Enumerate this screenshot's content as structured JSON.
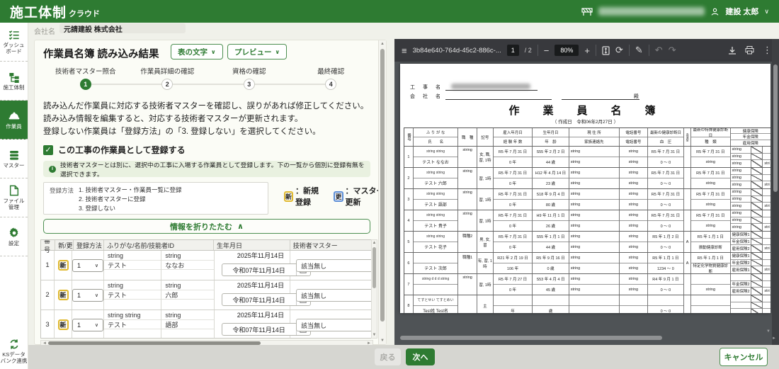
{
  "app": {
    "logo_main": "施工体制",
    "logo_sub": "クラウド",
    "user_name": "建設 太郎"
  },
  "sidebar": {
    "items": [
      {
        "id": "dashboard",
        "label": "ダッシュ\nボード",
        "icon": "checklist-icon",
        "active": false
      },
      {
        "id": "sekou-taisei",
        "label": "施工体制",
        "icon": "org-tree-icon",
        "active": false
      },
      {
        "id": "sagyouin",
        "label": "作業員",
        "icon": "helmet-icon",
        "active": true
      },
      {
        "id": "master",
        "label": "マスター",
        "icon": "database-icon",
        "active": false
      },
      {
        "id": "file-kanri",
        "label": "ファイル\n管理",
        "icon": "file-icon",
        "active": false
      },
      {
        "id": "settei",
        "label": "設定",
        "icon": "gear-icon",
        "active": false
      }
    ],
    "footer_item": {
      "id": "ks-databank",
      "label": "KSデータ\nバンク連携",
      "icon": "sync-icon"
    }
  },
  "company_bar": {
    "label": "会社名",
    "value": "元請建設 株式会社"
  },
  "panel": {
    "title": "作業員名簿 読み込み結果",
    "dropdown_table_text": "表の文字",
    "dropdown_preview": "プレビュー",
    "steps": [
      {
        "num": "1",
        "label": "技術者マスター照合",
        "active": true
      },
      {
        "num": "2",
        "label": "作業員詳細の確認",
        "active": false
      },
      {
        "num": "3",
        "label": "資格の確認",
        "active": false
      },
      {
        "num": "4",
        "label": "最終確認",
        "active": false
      }
    ],
    "description_lines": [
      "読み込んだ作業員に対応する技術者マスターを確認し、誤りがあれば修正してください。",
      "読み込み情報を編集すると、対応する技術者マスターが更新されます。",
      "登録しない作業員は「登録方法」の「3. 登録しない」を選択してください。"
    ],
    "register_checkbox_label": "この工事の作業員として登録する",
    "info_note": "技術者マスターとは別に、選択中の工事に入場する作業員として登録します。下の一覧から個別に登録有無を選択できます。",
    "legend": {
      "title": "登録方法",
      "options": [
        "1. 技術者マスター・作業員一覧に登録",
        "2. 技術者マスターに登録",
        "3. 登録しない"
      ],
      "badge_new": "新",
      "badge_new_label": "：新規登録",
      "badge_update": "更",
      "badge_update_label": "：マスター更新"
    },
    "collapse_button": "情報を折りたたむ",
    "collapse_chevron": "∧",
    "table": {
      "headers": [
        "番号",
        "新/更",
        "登録方法",
        "ふりがな/名前/技能者ID",
        "生年月日",
        "技術者マスター"
      ],
      "rows": [
        {
          "num": "1",
          "badge": "新",
          "method": "1",
          "kana_sei": "string",
          "kana_mei": "string",
          "sei": "テスト",
          "mei": "ななお",
          "birth_display": "2025年11月14日",
          "birth_input": "令和07年11月14日",
          "master": "該当無し",
          "partial": false
        },
        {
          "num": "2",
          "badge": "新",
          "method": "1",
          "kana_sei": "string",
          "kana_mei": "string",
          "sei": "テスト",
          "mei": "六郎",
          "birth_display": "2025年11月14日",
          "birth_input": "令和07年11月14日",
          "master": "該当無し",
          "partial": false
        },
        {
          "num": "3",
          "badge": "新",
          "method": "1",
          "kana_sei": "string string",
          "kana_mei": "string",
          "sei": "テスト",
          "mei": "語部",
          "birth_display": "2025年11月14日",
          "birth_input": "令和07年11月14日",
          "master": "該当無し",
          "partial": false
        },
        {
          "num": "",
          "badge": "",
          "method": "",
          "kana_sei": "string string",
          "kana_mei": "string",
          "sei": "",
          "mei": "",
          "birth_display": "H9 年 11 月 1 日",
          "birth_input": "",
          "master": "",
          "partial": true
        }
      ]
    }
  },
  "footer": {
    "back": "戻る",
    "next": "次へ",
    "cancel": "キャンセル"
  },
  "pdf": {
    "toolbar": {
      "filename": "3b84e640-764d-45c2-886c-...",
      "page": "1",
      "page_total": "/ 2",
      "zoom": "80%"
    },
    "doc": {
      "field_koji": "工　事　名",
      "field_kaisha": "会　社　名",
      "dono": "殿",
      "title": "作　業　員　名　簿",
      "date_line": "（ 作成日　令和06年2月27日 ）",
      "headers": {
        "num": "番号",
        "kana": "ふ り が な",
        "name": "氏　　名",
        "job": "職　種",
        "mark": "記号",
        "hire": "雇入年月日",
        "exp": "経 験 年 数",
        "birth": "生年月日",
        "age": "年　齢",
        "addr": "現 住 所",
        "family": "家族連絡先",
        "tel1": "電話番号",
        "tel2": "電話番号",
        "checkup": "最新の健康診断日",
        "bp": "血　圧",
        "blood": "血液型",
        "special": "最新の特殊健康診断日",
        "kind": "種　類",
        "ins1": "健康保険",
        "ins2": "年金保険",
        "ins3": "雇用保険"
      },
      "rows": [
        {
          "no": "1",
          "kana": "string string",
          "name": "テスト ななお",
          "job": "string",
          "mark": "女, 職, 習, 1特",
          "hire": "R5 年 7 月 31 日",
          "exp": "0 年",
          "birth": "S55 年 2 月 2 日",
          "age": "44 歳",
          "addr": "string",
          "family": "string",
          "tel1": "string",
          "tel2": "string",
          "checkup": "R5 年 7 月 31 日",
          "bp": "0 ～ 0",
          "blood": "",
          "special": "R5 年 7 月 31 日",
          "kind": "string",
          "ins": [
            "string",
            "string",
            "string"
          ],
          "cut": "stri"
        },
        {
          "no": "2",
          "kana": "string string",
          "name": "テスト 六郎",
          "job": "string",
          "mark": "習, 1時",
          "hire": "R5 年 7 月 31 日",
          "exp": "0 年",
          "birth": "H12 年 4 月 14 日",
          "age": "23 歳",
          "addr": "string",
          "family": "string",
          "tel1": "string",
          "tel2": "string",
          "checkup": "R5 年 7 月 31 日",
          "bp": "0 ～ 0",
          "blood": "",
          "special": "R5 年 7 月 31 日",
          "kind": "string",
          "ins": [
            "string",
            "string",
            "string"
          ],
          "cut": "stri"
        },
        {
          "no": "3",
          "kana": "string string",
          "name": "テスト 語部",
          "job": "string",
          "mark": "習, 1時",
          "hire": "R5 年 7 月 31 日",
          "exp": "0 年",
          "birth": "S18 年 9 月 4 日",
          "age": "80 歳",
          "addr": "string",
          "family": "string",
          "tel1": "string",
          "tel2": "string",
          "checkup": "R5 年 7 月 31 日",
          "bp": "0 ～ 0",
          "blood": "",
          "special": "R5 年 7 月 31 日",
          "kind": "string",
          "ins": [
            "string",
            "string",
            "string"
          ],
          "cut": "stri"
        },
        {
          "no": "4",
          "kana": "string string",
          "name": "テスト 貴子",
          "job": "string",
          "mark": "習, 1時",
          "hire": "R5 年 7 月 31 日",
          "exp": "0 年",
          "birth": "H9 年 11 月 1 日",
          "age": "26 歳",
          "addr": "string",
          "family": "string",
          "tel1": "string",
          "tel2": "string",
          "checkup": "R5 年 7 月 31 日",
          "bp": "0 ～ 0",
          "blood": "",
          "special": "R5 年 7 月 31 日",
          "kind": "string",
          "ins": [
            "string",
            "string",
            "string"
          ],
          "cut": "stri"
        },
        {
          "no": "5",
          "kana": "string string",
          "name": "テスト 花子",
          "job": "職種2",
          "mark": "男, 女, 習",
          "hire": "R5 年 7 月 31 日",
          "exp": "0 年",
          "birth": "S55 年 1 月 1 日",
          "age": "44 歳",
          "addr": "string",
          "family": "string",
          "tel1": "string",
          "tel2": "string",
          "checkup": "R5 年 1 月 2 日",
          "bp": "0 ～ 0",
          "blood": "A",
          "special": "R5 年 1 月 1 日",
          "kind": "振動健康診断",
          "ins": [
            "健康保険1",
            "年金保険1",
            "雇用保険2"
          ],
          "cut": "stri"
        },
        {
          "no": "6",
          "kana": "",
          "name": "テスト 次郎",
          "job": "職種1",
          "mark": "有, 習, 1時",
          "hire": "R21 年 2 月 19 日",
          "exp": "106 年",
          "birth": "R5 年 9 月 16 日",
          "age": "0 歳",
          "addr": "string",
          "family": "string",
          "tel1": "string",
          "tel2": "string",
          "checkup": "R5 年 1 月 1 日",
          "bp": "1234 ～ 0",
          "blood": "A",
          "special": "R5 年 1 月 1 日",
          "kind": "特定化学物質健康診断",
          "ins": [
            "健康保険1",
            "年金保険2",
            "雇用保険1"
          ],
          "cut": "stri"
        },
        {
          "no": "7",
          "kana": "string d d d string",
          "name": "",
          "job": "string",
          "mark": "習, 1時",
          "hire": "R5 年 7 月 27 日",
          "exp": "0 年",
          "birth": "S53 年 4 月 4 日",
          "age": "45 歳",
          "addr": "string",
          "family": "string",
          "tel1": "string",
          "tel2": "string",
          "checkup": "R4 年 9 月 1 日",
          "bp": "0 ～ 0",
          "blood": "",
          "special": "",
          "kind": "string",
          "ins": [
            "",
            "年金保険2",
            "雇用保険2"
          ],
          "cut": "stri"
        },
        {
          "no": "8",
          "kana": "てすとせい てすとめい",
          "name": "Test姓 Test名",
          "job": "",
          "mark": "主",
          "hire": "",
          "exp": "年",
          "birth": "",
          "age": "歳",
          "addr": "",
          "family": "",
          "tel1": "",
          "tel2": "",
          "checkup": "",
          "bp": "0 ～ 0",
          "blood": "",
          "special": "",
          "kind": "",
          "ins": [
            "",
            "",
            ""
          ],
          "cut": ""
        }
      ]
    }
  }
}
